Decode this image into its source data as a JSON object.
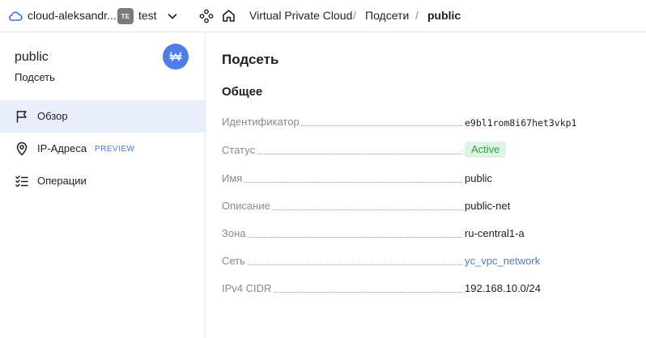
{
  "topbar": {
    "cloud_name": "cloud-aleksandr...",
    "folder_badge": "TE",
    "folder_name": "test",
    "breadcrumbs": [
      {
        "label": "Virtual Private Cloud"
      },
      {
        "label": "Подсети"
      },
      {
        "label": "public"
      }
    ],
    "separator": "/"
  },
  "sidebar": {
    "title": "public",
    "subtitle": "Подсеть",
    "badge_icon": "subnet-icon",
    "items": [
      {
        "label": "Обзор",
        "icon": "flag-icon",
        "active": true,
        "tag": ""
      },
      {
        "label": "IP-Адреса",
        "icon": "location-pin-icon",
        "active": false,
        "tag": "PREVIEW"
      },
      {
        "label": "Операции",
        "icon": "checklist-icon",
        "active": false,
        "tag": ""
      }
    ]
  },
  "main": {
    "title": "Подсеть",
    "section_title": "Общее",
    "properties": [
      {
        "label": "Идентификатор",
        "value": "e9bl1rom8i67het3vkp1"
      },
      {
        "label": "Статус",
        "value": "Active"
      },
      {
        "label": "Имя",
        "value": "public"
      },
      {
        "label": "Описание",
        "value": "public-net"
      },
      {
        "label": "Зона",
        "value": "ru-central1-a"
      },
      {
        "label": "Сеть",
        "value": "yc_vpc_network"
      },
      {
        "label": "IPv4 CIDR",
        "value": "192.168.10.0/24"
      }
    ]
  },
  "colors": {
    "accent": "#4f7de8",
    "link": "#4d7ad9",
    "active_nav_bg": "#e8eefb",
    "status_bg": "#dff5e3",
    "status_text": "#2f9e44"
  }
}
